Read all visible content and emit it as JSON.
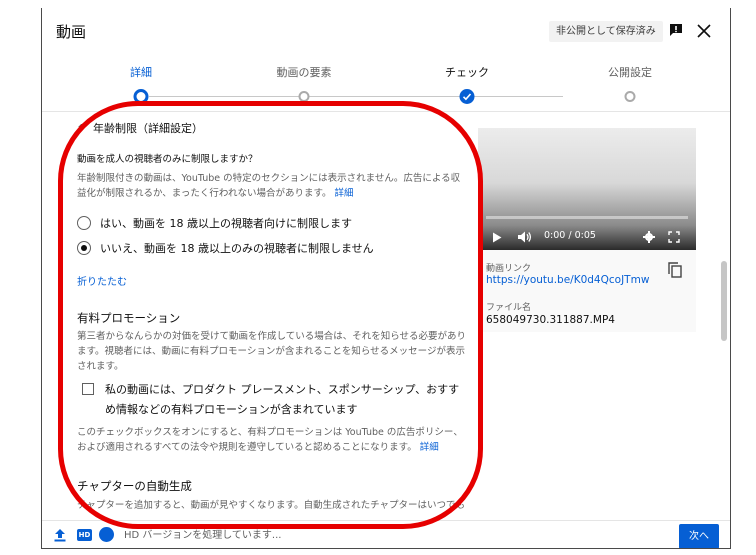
{
  "header": {
    "title": "動画",
    "draft_badge": "非公開として保存済み",
    "icons": {
      "feedback": "feedback-icon",
      "close": "close-icon"
    }
  },
  "stepper": {
    "steps": [
      {
        "label": "詳細",
        "state": "current"
      },
      {
        "label": "動画の要素",
        "state": "pending"
      },
      {
        "label": "チェック",
        "state": "done"
      },
      {
        "label": "公開設定",
        "state": "pending"
      }
    ]
  },
  "age_restriction": {
    "heading": "年齢制限（詳細設定）",
    "question": "動画を成人の視聴者のみに制限しますか？",
    "description": "年齢制限付きの動画は、YouTube の特定のセクションには表示されません。広告による収益化が制限されるか、まったく行われない場合があります。",
    "details_link": "詳細",
    "option_yes": "はい、動画を 18 歳以上の視聴者向けに制限します",
    "option_no": "いいえ、動画を 18 歳以上のみの視聴者に制限しません",
    "selected": "no",
    "collapse_link": "折りたたむ"
  },
  "paid_promotion": {
    "heading": "有料プロモーション",
    "description": "第三者からなんらかの対価を受けて動画を作成している場合は、それを知らせる必要があります。視聴者には、動画に有料プロモーションが含まれることを知らせるメッセージが表示されます。",
    "checkbox_label": "私の動画には、プロダクト プレースメント、スポンサーシップ、おすすめ情報などの有料プロモーションが含まれています",
    "checked": false,
    "note": "このチェックボックスをオンにすると、有料プロモーションは YouTube の広告ポリシー、および適用されるすべての法令や規則を遵守していると認めることになります。",
    "details_link": "詳細"
  },
  "chapters": {
    "heading": "チャプターの自動生成",
    "description": "チャプターを追加すると、動画が見やすくなります。自動生成されたチャプターはいつでも"
  },
  "preview": {
    "time": "0:00 / 0:05",
    "progress": 0,
    "link_label": "動画リンク",
    "link": "https://youtu.be/K0d4QcoJTmw",
    "filename_label": "ファイル名",
    "filename": "658049730.311887.MP4"
  },
  "footer": {
    "status": "HD バージョンを処理しています...",
    "next_label": "次へ"
  },
  "colors": {
    "accent": "#065fd4",
    "annotation": "#e60000"
  }
}
